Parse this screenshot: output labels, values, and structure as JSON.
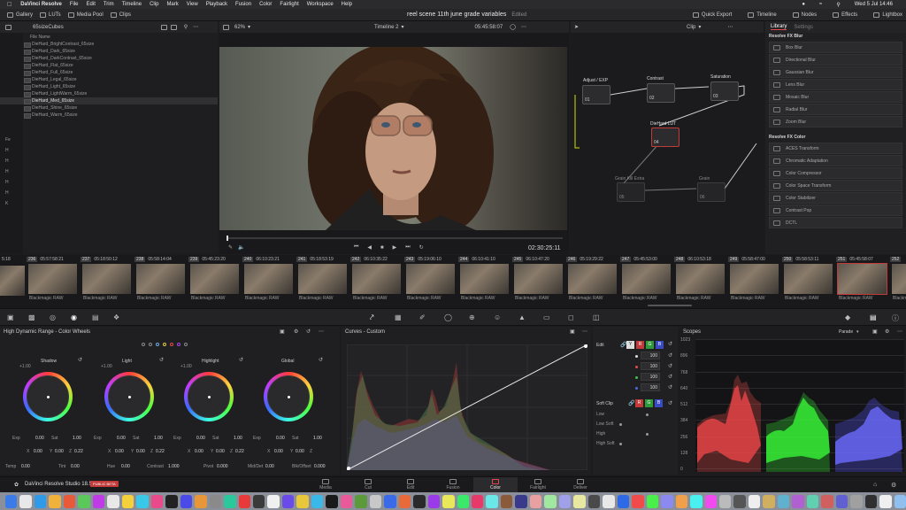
{
  "menubar": {
    "app_name": "DaVinci Resolve",
    "menus": [
      "File",
      "Edit",
      "Trim",
      "Timeline",
      "Clip",
      "Mark",
      "View",
      "Playback",
      "Fusion",
      "Color",
      "Fairlight",
      "Workspace",
      "Help"
    ],
    "clock": "Wed 5 Jul 14:46"
  },
  "toolbar": {
    "gallery": "Gallery",
    "luts": "LUTs",
    "media_pool": "Media Pool",
    "clips": "Clips",
    "project_title": "reel scene 11th june grade variables",
    "project_status": "Edited",
    "quick_export": "Quick Export",
    "timeline": "Timeline",
    "nodes": "Nodes",
    "effects": "Effects",
    "lightbox": "Lightbox"
  },
  "subbar": {
    "folder_title": "65sizeCubes",
    "zoom": "62%",
    "timeline_name": "Timeline 2",
    "timecode": "05:45:58:07",
    "clip_mode": "Clip",
    "library_tab": "Library",
    "settings_tab": "Settings"
  },
  "luts": {
    "header": "File Name",
    "items": [
      "DieHard_BrightContrast_65size",
      "DieHard_Dark_65size",
      "DieHard_DarkContrast_65size",
      "DieHard_Flat_65size",
      "DieHard_Full_65size",
      "DieHard_Legal_65size",
      "DieHard_Light_65size",
      "DieHard_LightWarm_65size",
      "DieHard_Med_65size",
      "DieHard_Shine_65size",
      "DieHard_Warm_65size"
    ],
    "selected_index": 8,
    "side_letters": [
      "Fe",
      "H",
      "H",
      "H",
      "H",
      "H",
      "K"
    ]
  },
  "viewer": {
    "timecode": "02:30:25:11"
  },
  "nodes": [
    {
      "label": "Adjust / EXP",
      "num": "01"
    },
    {
      "label": "Contrast",
      "num": "02"
    },
    {
      "label": "Saturation",
      "num": "03"
    },
    {
      "label": "DieHard LUT",
      "num": "04"
    },
    {
      "label": "Grain Kill Extra",
      "num": "05"
    },
    {
      "label": "Grain",
      "num": "06"
    }
  ],
  "library": {
    "blur_header": "Resolve FX Blur",
    "blur_items": [
      "Box Blur",
      "Directional Blur",
      "Gaussian Blur",
      "Lens Blur",
      "Mosaic Blur",
      "Radial Blur",
      "Zoom Blur"
    ],
    "color_header": "Resolve FX Color",
    "color_items": [
      "ACES Transform",
      "Chromatic Adaptation",
      "Color Compressor",
      "Color Space Transform",
      "Color Stabilizer",
      "Contrast Pop",
      "DCTL"
    ]
  },
  "clips": [
    {
      "num": "236",
      "tc": "05:57:58:21",
      "label": "Blackmagic RAW"
    },
    {
      "num": "237",
      "tc": "05:18:50:12",
      "label": "Blackmagic RAW"
    },
    {
      "num": "238",
      "tc": "05:58:14:04",
      "label": "Blackmagic RAW"
    },
    {
      "num": "239",
      "tc": "05:45:23:20",
      "label": "Blackmagic RAW"
    },
    {
      "num": "240",
      "tc": "06:10:23:21",
      "label": "Blackmagic RAW"
    },
    {
      "num": "241",
      "tc": "05:18:53:19",
      "label": "Blackmagic RAW"
    },
    {
      "num": "242",
      "tc": "06:10:35:22",
      "label": "Blackmagic RAW"
    },
    {
      "num": "243",
      "tc": "05:19:06:10",
      "label": "Blackmagic RAW"
    },
    {
      "num": "244",
      "tc": "06:10:41:10",
      "label": "Blackmagic RAW"
    },
    {
      "num": "245",
      "tc": "06:10:47:20",
      "label": "Blackmagic RAW"
    },
    {
      "num": "246",
      "tc": "05:19:29:22",
      "label": "Blackmagic RAW"
    },
    {
      "num": "247",
      "tc": "05:45:53:00",
      "label": "Blackmagic RAW"
    },
    {
      "num": "248",
      "tc": "06:10:53:18",
      "label": "Blackmagic RAW"
    },
    {
      "num": "249",
      "tc": "05:58:47:00",
      "label": "Blackmagic RAW"
    },
    {
      "num": "250",
      "tc": "05:58:53:11",
      "label": "Blackmagic RAW"
    },
    {
      "num": "251",
      "tc": "05:45:58:07",
      "label": "Blackmagic RAW"
    },
    {
      "num": "252",
      "tc": "",
      "label": "Blackm"
    }
  ],
  "first_clip_tc": "5:18",
  "wheels": {
    "title": "High Dynamic Range - Color Wheels",
    "items": [
      {
        "name": "Shadow",
        "exp": "0.00",
        "sat": "1.00",
        "x": "0.00",
        "y": "0.00",
        "z": "0.22",
        "lvl": "+1.00"
      },
      {
        "name": "Light",
        "exp": "0.00",
        "sat": "1.00",
        "x": "0.00",
        "y": "0.00",
        "z": "0.22",
        "lvl": "+1.00"
      },
      {
        "name": "Highlight",
        "exp": "0.00",
        "sat": "1.00",
        "x": "0.00",
        "y": "0.00",
        "z": "0.22",
        "lvl": "+1.00"
      },
      {
        "name": "Global",
        "exp": "0.00",
        "sat": "1.00",
        "x": "0.00",
        "y": "0.00",
        "z": "",
        "lvl": ""
      }
    ],
    "bottom": [
      {
        "k": "Temp",
        "v": "0.00"
      },
      {
        "k": "Tint",
        "v": "0.00"
      },
      {
        "k": "Hue",
        "v": "0.00"
      },
      {
        "k": "Contrast",
        "v": "1.000"
      },
      {
        "k": "Pivot",
        "v": "0.000"
      },
      {
        "k": "Mid/Det",
        "v": "0.00"
      },
      {
        "k": "Blk/Offset",
        "v": "0.000"
      }
    ]
  },
  "curves": {
    "title": "Curves - Custom"
  },
  "curve_panel": {
    "edit": "Edit",
    "channels": [
      "Y",
      "R",
      "G",
      "B"
    ],
    "values": [
      "100",
      "100",
      "100",
      "100"
    ],
    "soft_clip": "Soft Clip",
    "soft_items": [
      "Low",
      "Low Soft",
      "High",
      "High Soft"
    ]
  },
  "scopes": {
    "title": "Scopes",
    "mode": "Parade",
    "ticks": [
      "1023",
      "896",
      "768",
      "640",
      "512",
      "384",
      "256",
      "128",
      "0"
    ]
  },
  "pages": [
    "Media",
    "Cut",
    "Edit",
    "Fusion",
    "Color",
    "Fairlight",
    "Deliver"
  ],
  "active_page": "Color",
  "footer": {
    "brand": "DaVinci Resolve Studio 18.5",
    "badge": "PUBLIC BETA"
  },
  "colors": {
    "accent": "#e24a4a",
    "selected_outline": "#c23b3b"
  }
}
